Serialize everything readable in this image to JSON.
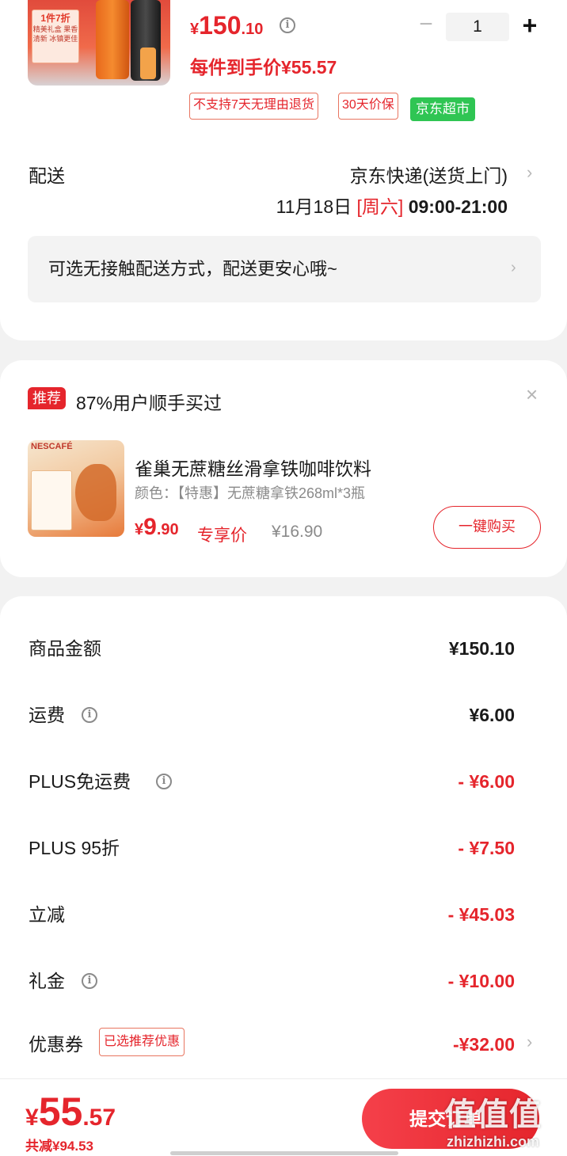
{
  "product": {
    "thumb_badge_title": "1件7折",
    "thumb_badge_text": "精美礼盒 果香清新 冰镇更佳",
    "price_symbol": "¥",
    "price_int": "150",
    "price_dec": ".10",
    "per_item_price": "每件到手价¥55.57",
    "quantity": "1",
    "minus_label": "−",
    "plus_label": "+",
    "tags": [
      "不支持7天无理由退货",
      "30天价保"
    ],
    "store_tag": "京东超市"
  },
  "shipping": {
    "label": "配送",
    "method": "京东快递(送货上门)",
    "date": "11月18日",
    "weekday": "[周六]",
    "hours": "09:00-21:00",
    "notice": "可选无接触配送方式，配送更安心哦~"
  },
  "recommend": {
    "badge": "推荐",
    "title": "87%用户顺手买过",
    "close": "×",
    "thumb_brand": "NESCAFÉ",
    "name": "雀巢无蔗糖丝滑拿铁咖啡饮料",
    "spec": "颜色：【特惠】无蔗糖拿铁268ml*3瓶",
    "price_symbol": "¥",
    "price_int": "9",
    "price_dec": ".90",
    "price_tag": "专享价",
    "original_price": "¥16.90",
    "buy_label": "一键购买"
  },
  "summary": {
    "rows": [
      {
        "label": "商品金额",
        "value": "¥150.10"
      },
      {
        "label": "运费",
        "value": "¥6.00"
      },
      {
        "label": "PLUS免运费",
        "value": "- ¥6.00"
      },
      {
        "label": "PLUS 95折",
        "value": "- ¥7.50"
      },
      {
        "label": "立减",
        "value": "- ¥45.03"
      },
      {
        "label": "礼金",
        "value": "- ¥10.00"
      },
      {
        "label": "优惠券",
        "value": "-¥32.00",
        "tag": "已选推荐优惠"
      }
    ]
  },
  "bottom": {
    "price_symbol": "¥",
    "price_int": "55",
    "price_dec": ".57",
    "saved": "共减¥94.53",
    "submit_label": "提交订单",
    "watermark_logo": "值值值",
    "watermark_url": "zhizhizhi.com"
  },
  "colors": {
    "accent": "#e5252c",
    "store_green": "#2fc553",
    "muted": "#8a8a8a"
  }
}
